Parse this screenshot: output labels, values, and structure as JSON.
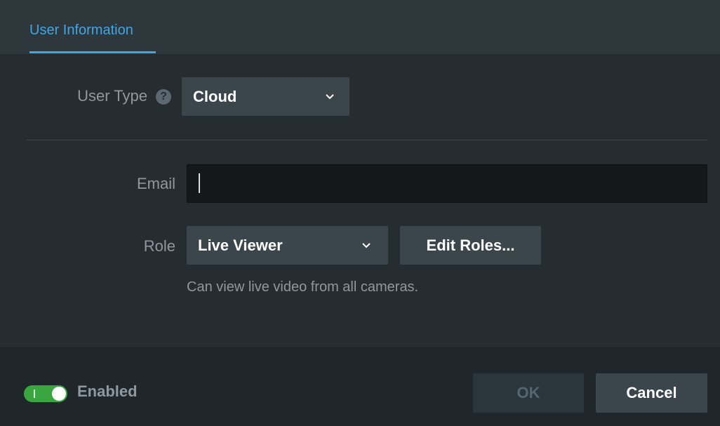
{
  "tabs": [
    {
      "label": "User Information",
      "active": true
    }
  ],
  "user_type": {
    "label": "User Type",
    "help_icon": "question-circle",
    "selected": "Cloud"
  },
  "email": {
    "label": "Email",
    "value": "",
    "placeholder": ""
  },
  "role": {
    "label": "Role",
    "selected": "Live Viewer",
    "edit_button": "Edit Roles...",
    "description": "Can view live video from all cameras."
  },
  "footer": {
    "enabled_label": "Enabled",
    "enabled": true,
    "ok_label": "OK",
    "ok_disabled": true,
    "cancel_label": "Cancel"
  },
  "colors": {
    "accent": "#3fa7e6",
    "toggle_on": "#3aa63f",
    "panel": "#262d31"
  }
}
